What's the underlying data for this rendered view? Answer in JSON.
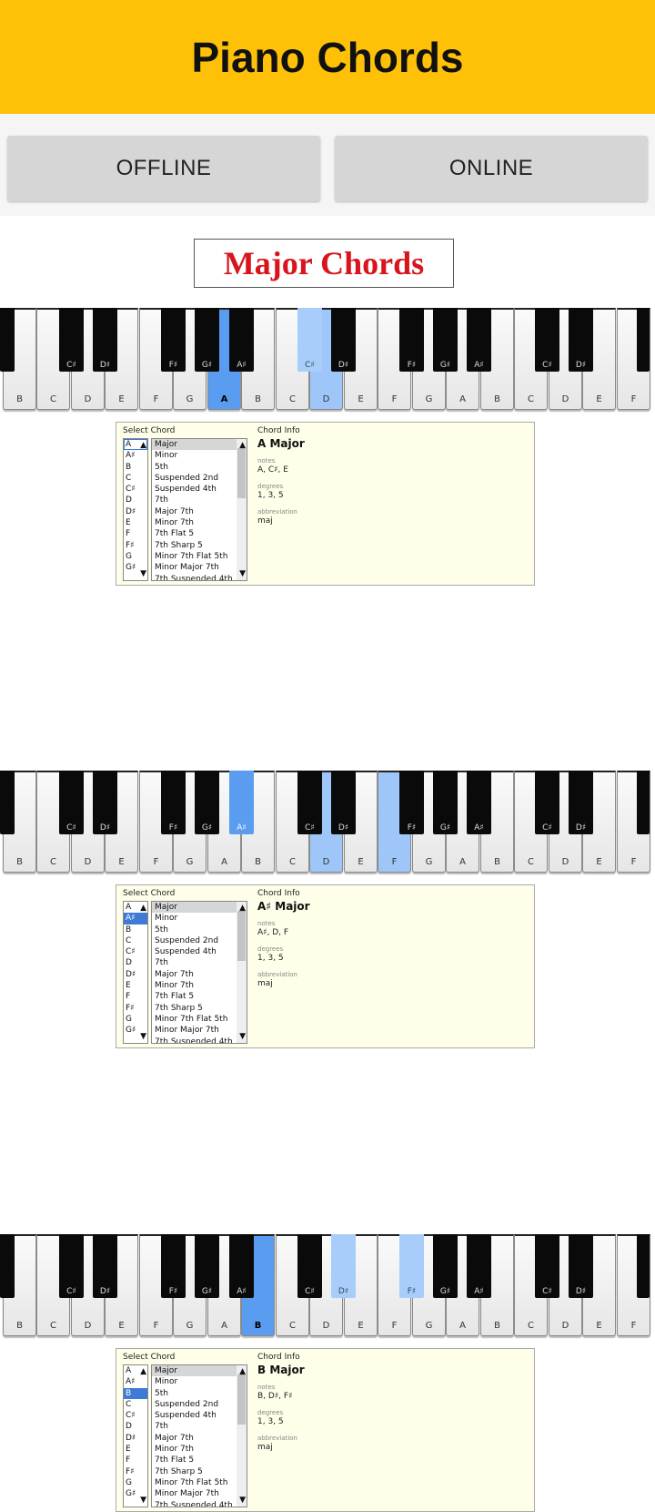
{
  "app": {
    "title": "Piano Chords"
  },
  "mode_buttons": {
    "offline": "OFFLINE",
    "online": "ONLINE"
  },
  "section_title": "Major Chords",
  "keyboard": {
    "white_keys": [
      "B",
      "C",
      "D",
      "E",
      "F",
      "G",
      "A",
      "B",
      "C",
      "D",
      "E",
      "F",
      "G",
      "A",
      "B",
      "C",
      "D",
      "E",
      "F"
    ],
    "black_keys": [
      "C♯",
      "D♯",
      "F♯",
      "G♯",
      "A♯",
      "C♯",
      "D♯",
      "F♯",
      "G♯",
      "A♯",
      "C♯",
      "D♯"
    ]
  },
  "panel_labels": {
    "select_chord": "Select Chord",
    "chord_info": "Chord Info",
    "notes": "notes",
    "degrees": "degrees",
    "abbreviation": "abbreviation"
  },
  "roots": [
    "A",
    "A♯",
    "B",
    "C",
    "C♯",
    "D",
    "D♯",
    "E",
    "F",
    "F♯",
    "G",
    "G♯"
  ],
  "chord_types": [
    "Major",
    "Minor",
    "5th",
    "Suspended 2nd",
    "Suspended 4th",
    "7th",
    "Major 7th",
    "Minor 7th",
    "7th Flat 5",
    "7th Sharp 5",
    "Minor 7th Flat 5th",
    "Minor Major 7th",
    "7th Suspended 4th"
  ],
  "chords": [
    {
      "name": "A Major",
      "notes": "A, C♯, E",
      "degrees": "1, 3, 5",
      "abbreviation": "maj"
    },
    {
      "name": "A♯ Major",
      "notes": "A♯, D, F",
      "degrees": "1, 3, 5",
      "abbreviation": "maj"
    },
    {
      "name": "B Major",
      "notes": "B, D♯, F♯",
      "degrees": "1, 3, 5",
      "abbreviation": "maj"
    }
  ]
}
